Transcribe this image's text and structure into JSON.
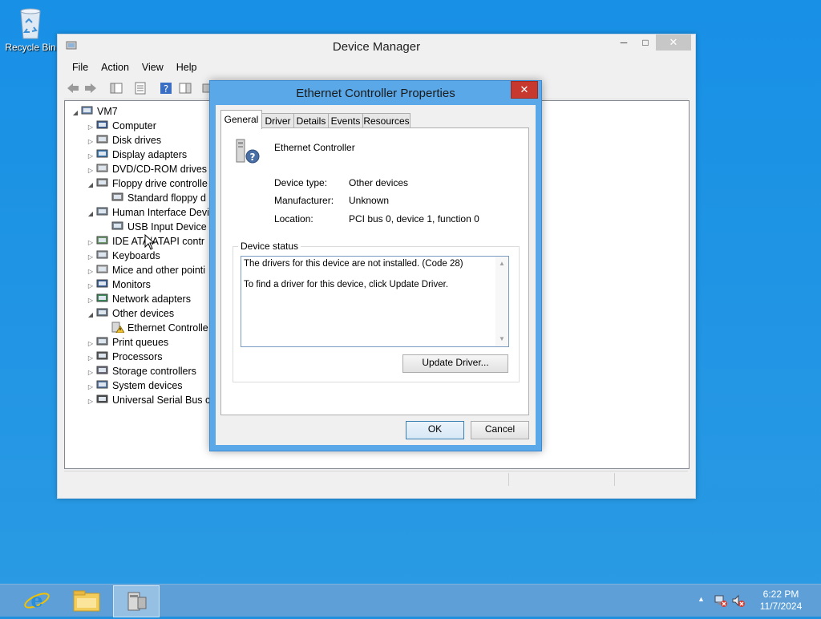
{
  "desktop": {
    "recycle_bin_label": "Recycle Bin"
  },
  "device_manager": {
    "title": "Device Manager",
    "menu": [
      "File",
      "Action",
      "View",
      "Help"
    ],
    "tree": [
      {
        "label": "VM7",
        "level": 0,
        "expanded": true,
        "icon": "computer-icon"
      },
      {
        "label": "Computer",
        "level": 1,
        "expanded": false,
        "icon": "monitor-icon"
      },
      {
        "label": "Disk drives",
        "level": 1,
        "expanded": false,
        "icon": "disk-icon"
      },
      {
        "label": "Display adapters",
        "level": 1,
        "expanded": false,
        "icon": "display-adapter-icon"
      },
      {
        "label": "DVD/CD-ROM drives",
        "level": 1,
        "expanded": false,
        "icon": "dvd-icon"
      },
      {
        "label": "Floppy drive controlle",
        "level": 1,
        "expanded": true,
        "icon": "floppy-controller-icon"
      },
      {
        "label": "Standard floppy d",
        "level": 2,
        "expanded": null,
        "icon": "floppy-controller-icon"
      },
      {
        "label": "Human Interface Devi",
        "level": 1,
        "expanded": true,
        "icon": "hid-icon"
      },
      {
        "label": "USB Input Device",
        "level": 2,
        "expanded": null,
        "icon": "hid-icon"
      },
      {
        "label": "IDE ATA/ATAPI contr",
        "level": 1,
        "expanded": false,
        "icon": "ide-icon"
      },
      {
        "label": "Keyboards",
        "level": 1,
        "expanded": false,
        "icon": "keyboard-icon"
      },
      {
        "label": "Mice and other pointi",
        "level": 1,
        "expanded": false,
        "icon": "mouse-icon"
      },
      {
        "label": "Monitors",
        "level": 1,
        "expanded": false,
        "icon": "monitor-icon"
      },
      {
        "label": "Network adapters",
        "level": 1,
        "expanded": false,
        "icon": "network-adapter-icon"
      },
      {
        "label": "Other devices",
        "level": 1,
        "expanded": true,
        "icon": "unknown-device-icon"
      },
      {
        "label": "Ethernet Controlle",
        "level": 2,
        "expanded": null,
        "icon": "warning-device-icon"
      },
      {
        "label": "Print queues",
        "level": 1,
        "expanded": false,
        "icon": "printer-icon"
      },
      {
        "label": "Processors",
        "level": 1,
        "expanded": false,
        "icon": "processor-icon"
      },
      {
        "label": "Storage controllers",
        "level": 1,
        "expanded": false,
        "icon": "storage-icon"
      },
      {
        "label": "System devices",
        "level": 1,
        "expanded": false,
        "icon": "system-device-icon"
      },
      {
        "label": "Universal Serial Bus co",
        "level": 1,
        "expanded": false,
        "icon": "usb-icon"
      }
    ]
  },
  "dialog": {
    "title": "Ethernet Controller Properties",
    "tabs": [
      "General",
      "Driver",
      "Details",
      "Events",
      "Resources"
    ],
    "active_tab": "General",
    "device_name": "Ethernet Controller",
    "props": [
      {
        "label": "Device type:",
        "value": "Other devices"
      },
      {
        "label": "Manufacturer:",
        "value": "Unknown"
      },
      {
        "label": "Location:",
        "value": "PCI bus 0, device 1, function 0"
      }
    ],
    "status_group_title": "Device status",
    "status_lines": [
      "The drivers for this device are not installed. (Code 28)",
      "To find a driver for this device, click Update Driver."
    ],
    "update_driver_label": "Update Driver...",
    "ok_label": "OK",
    "cancel_label": "Cancel"
  },
  "taskbar": {
    "time": "6:22 PM",
    "date": "11/7/2024"
  }
}
